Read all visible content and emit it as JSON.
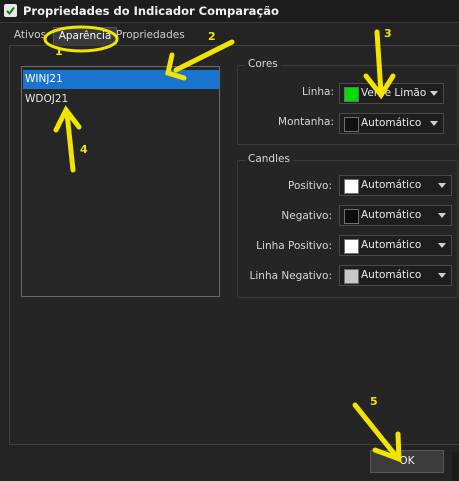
{
  "window": {
    "title": "Propriedades do Indicador Comparação",
    "icon": "check-icon"
  },
  "tabs": [
    {
      "label": "Ativos",
      "active": false
    },
    {
      "label": "Aparência",
      "active": true
    },
    {
      "label": "Propriedades",
      "active": false
    }
  ],
  "assets": [
    {
      "label": "WINJ21",
      "selected": true
    },
    {
      "label": "WDOJ21",
      "selected": false
    }
  ],
  "cores": {
    "title": "Cores",
    "rows": [
      {
        "label": "Linha:",
        "value": "Verde Limão",
        "color": "#00e000"
      },
      {
        "label": "Montanha:",
        "value": "Automático",
        "color": "#101014"
      }
    ]
  },
  "candles": {
    "title": "Candles",
    "rows": [
      {
        "label": "Positivo:",
        "value": "Automático",
        "color": "#ffffff"
      },
      {
        "label": "Negativo:",
        "value": "Automático",
        "color": "#0c0c0c"
      },
      {
        "label": "Linha Positivo:",
        "value": "Automático",
        "color": "#ffffff"
      },
      {
        "label": "Linha Negativo:",
        "value": "Automático",
        "color": "#c8c8c8"
      }
    ]
  },
  "ok_label": "OK",
  "annotations": {
    "color": "#f0e400",
    "numbers": [
      "1",
      "2",
      "3",
      "4",
      "5"
    ]
  }
}
